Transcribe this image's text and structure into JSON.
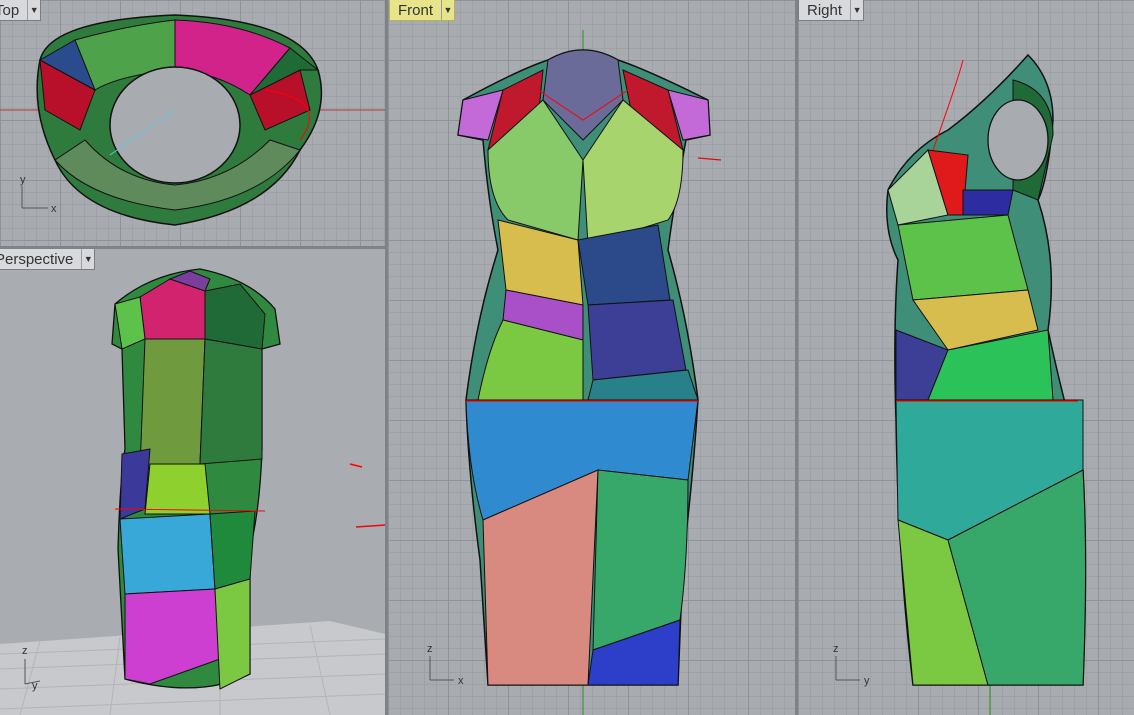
{
  "viewports": {
    "top": {
      "label": "Top"
    },
    "perspective": {
      "label": "Perspective"
    },
    "front": {
      "label": "Front"
    },
    "right": {
      "label": "Right"
    }
  },
  "axes": {
    "top": [
      "y",
      "x"
    ],
    "perspective": [
      "z",
      "y"
    ],
    "front": [
      "z",
      "x"
    ],
    "right": [
      "z",
      "y"
    ]
  },
  "colors": {
    "viewport_bg": "#a8abb0",
    "active_tab": "#e8e48a",
    "curve": "#ff0000",
    "seam": "#111111"
  }
}
